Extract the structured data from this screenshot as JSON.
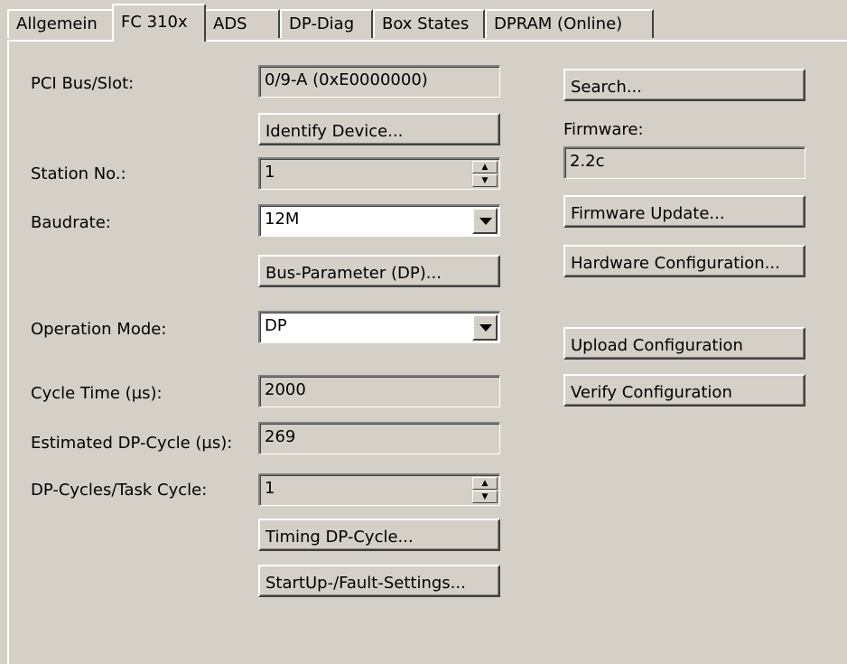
{
  "tabs": [
    "Allgemein",
    "FC 310x",
    "ADS",
    "DP-Diag",
    "Box States",
    "DPRAM (Online)"
  ],
  "labels": {
    "pci": "PCI Bus/Slot:",
    "station": "Station No.:",
    "baudrate": "Baudrate:",
    "opmode": "Operation Mode:",
    "cycle": "Cycle Time (µs):",
    "estimated": "Estimated DP-Cycle (µs):",
    "dpcycles": "DP-Cycles/Task Cycle:",
    "firmware": "Firmware:"
  },
  "values": {
    "pci": "0/9-A (0xE0000000)",
    "station": "1",
    "baudrate": "12M",
    "opmode": "DP",
    "cycle": "2000",
    "estimated": "269",
    "dpcycles": "1",
    "firmware": "2.2c"
  },
  "buttons": {
    "identify": "Identify Device...",
    "busparam": "Bus-Parameter (DP)...",
    "timing": "Timing DP-Cycle...",
    "startup": "StartUp-/Fault-Settings...",
    "search": "Search...",
    "fwupdate": "Firmware Update...",
    "hwconfig": "Hardware Configuration...",
    "upload": "Upload Configuration",
    "verify": "Verify Configuration"
  }
}
